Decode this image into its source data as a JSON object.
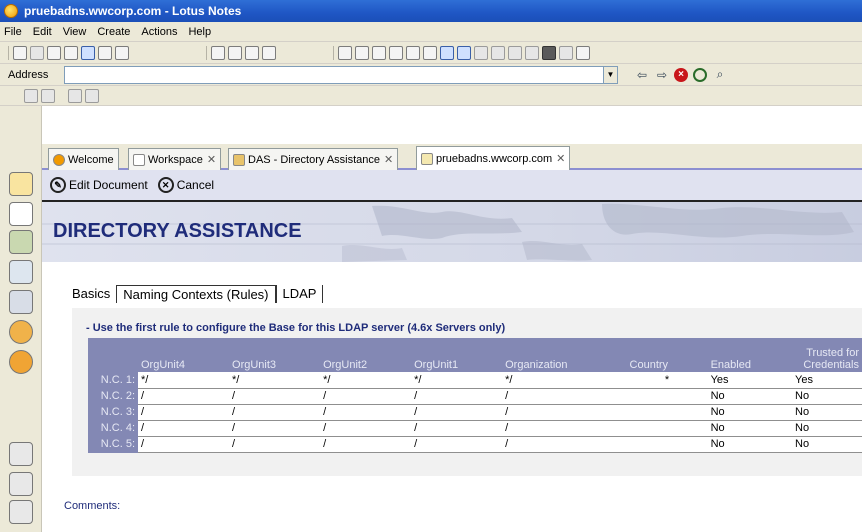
{
  "window": {
    "title": "pruebadns.wwcorp.com - Lotus Notes"
  },
  "menu": [
    "File",
    "Edit",
    "View",
    "Create",
    "Actions",
    "Help"
  ],
  "address": {
    "label": "Address",
    "value": ""
  },
  "tabs": [
    {
      "label": "Welcome",
      "icon": "notes-globe-icon"
    },
    {
      "label": "Workspace",
      "icon": "workspace-icon"
    },
    {
      "label": "DAS - Directory Assistance",
      "icon": "directory-icon"
    },
    {
      "label": "pruebadns.wwcorp.com",
      "icon": "document-icon",
      "active": true
    }
  ],
  "actions": {
    "edit": "Edit Document",
    "cancel": "Cancel"
  },
  "banner": {
    "title": "DIRECTORY ASSISTANCE"
  },
  "subtabs": [
    "Basics",
    "Naming Contexts (Rules)",
    "LDAP"
  ],
  "rules": {
    "heading": "- Use the first rule to configure the Base for this LDAP server (4.6x Servers only)",
    "columns": [
      "",
      "OrgUnit4",
      "OrgUnit3",
      "OrgUnit2",
      "OrgUnit1",
      "Organization",
      "Country",
      "Enabled",
      "Trusted for Credentials"
    ],
    "rows": [
      {
        "label": "N.C. 1:",
        "cells": [
          "*/",
          "*/",
          "*/",
          "*/",
          "*/",
          "*",
          "Yes",
          "Yes"
        ]
      },
      {
        "label": "N.C. 2:",
        "cells": [
          "/",
          "/",
          "/",
          "/",
          "/",
          "",
          "No",
          "No"
        ]
      },
      {
        "label": "N.C. 3:",
        "cells": [
          "/",
          "/",
          "/",
          "/",
          "/",
          "",
          "No",
          "No"
        ]
      },
      {
        "label": "N.C. 4:",
        "cells": [
          "/",
          "/",
          "/",
          "/",
          "/",
          "",
          "No",
          "No"
        ]
      },
      {
        "label": "N.C. 5:",
        "cells": [
          "/",
          "/",
          "/",
          "/",
          "/",
          "",
          "No",
          "No"
        ]
      }
    ]
  },
  "comments_label": "Comments:",
  "colors": {
    "titlebar": "#1f56c4",
    "table_header": "#8388b4",
    "banner_text": "#1f2c7a"
  }
}
